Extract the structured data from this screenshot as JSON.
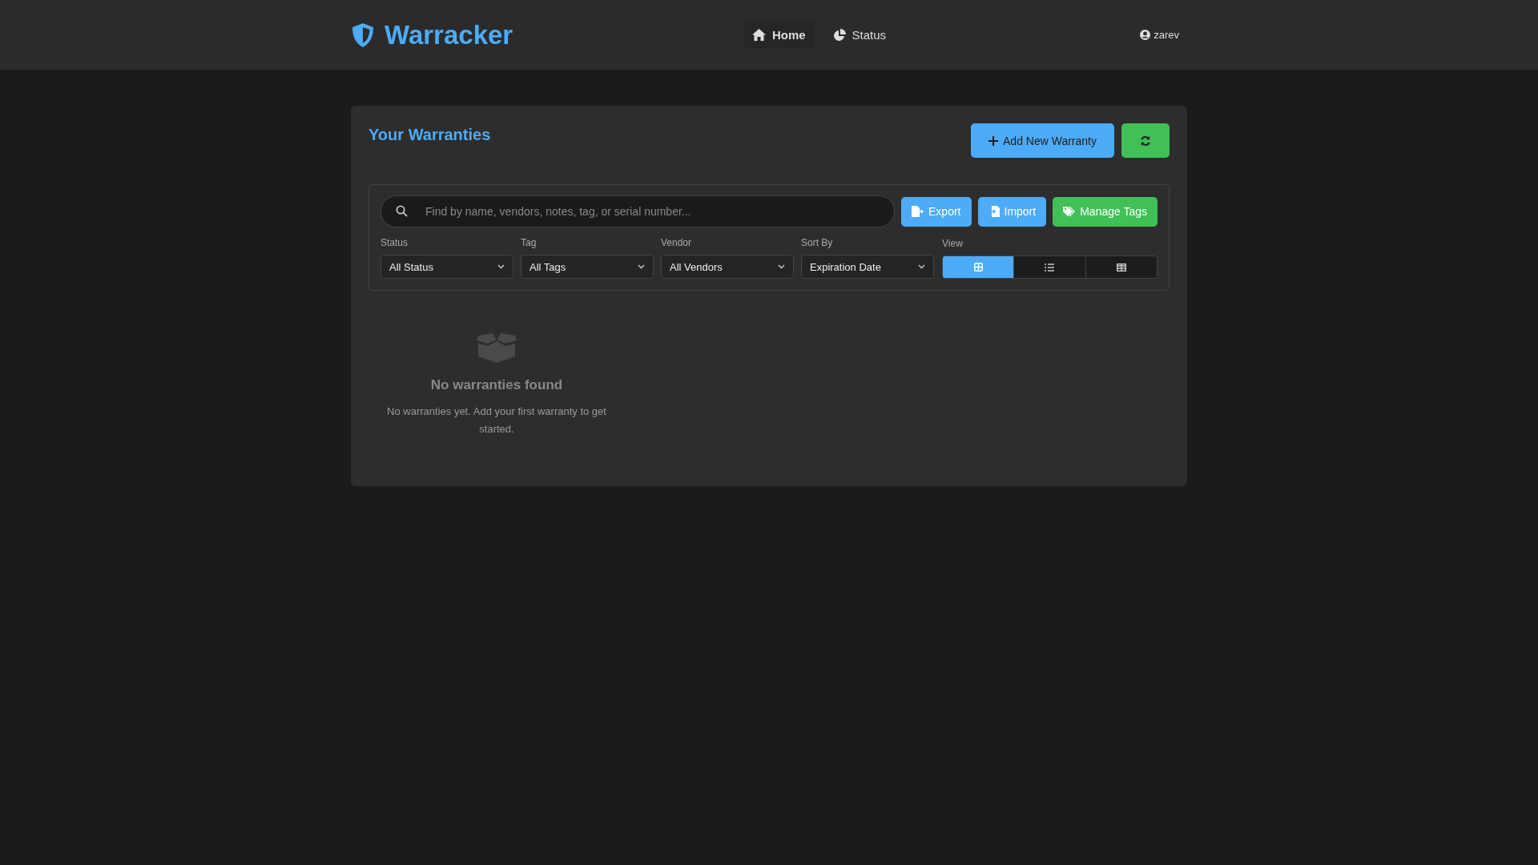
{
  "header": {
    "brand": "Warracker",
    "nav": [
      {
        "label": "Home",
        "kind": "home",
        "selected": true
      },
      {
        "label": "Status",
        "kind": "status",
        "selected": false
      }
    ],
    "user": "zarev"
  },
  "page": {
    "title": "Your Warranties",
    "add_button": "Add New Warranty"
  },
  "toolbar": {
    "search": {
      "placeholder": "Find by name, vendors, notes, tag, or serial number..."
    },
    "buttons": [
      {
        "label": "Export",
        "kind": "export"
      },
      {
        "label": "Import",
        "kind": "import"
      },
      {
        "label": "Manage Tags",
        "kind": "tags"
      }
    ],
    "filters": [
      {
        "label": "Status",
        "value": "All Status"
      },
      {
        "label": "Tag",
        "value": "All Tags"
      },
      {
        "label": "Vendor",
        "value": "All Vendors"
      },
      {
        "label": "Sort By",
        "value": "Expiration Date"
      }
    ],
    "view": {
      "label": "View",
      "options": [
        {
          "kind": "grid",
          "selected": true
        },
        {
          "kind": "list",
          "selected": false
        },
        {
          "kind": "table",
          "selected": false
        }
      ]
    }
  },
  "empty_state": {
    "title": "No warranties found",
    "message": "No warranties yet. Add your first warranty to get started."
  }
}
